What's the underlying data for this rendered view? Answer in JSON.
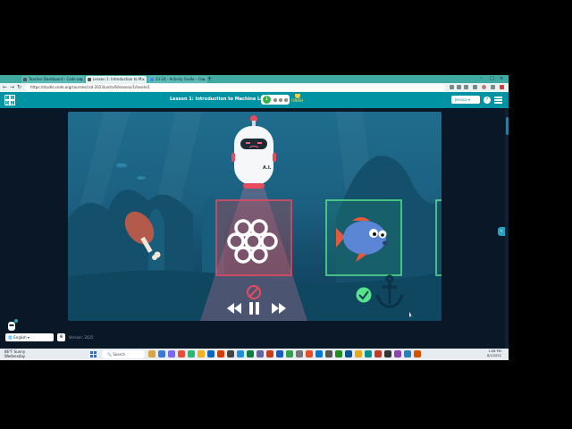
{
  "browser": {
    "tabs": [
      {
        "title": "Teacher Dashboard - Code.org"
      },
      {
        "title": "Lesson 1: Introduction to M..."
      },
      {
        "title": "23-24 - Activity Guide - Clo..."
      }
    ],
    "url": "https://studio.code.org/courses/csd-2023/units/6/lessons/1/levels/1"
  },
  "app": {
    "lesson_title": "Lesson 1: Introduction to Machine Learning",
    "progress_number": "1",
    "finish_label": "FINISH",
    "account_label": "Jessica",
    "help_label": "?",
    "robot_label": "A.I.",
    "language": "English",
    "language_button": "⊕",
    "version_text": "Version: 2025"
  },
  "taskbar": {
    "weather_temp": "86°F",
    "weather_desc": "Sunny",
    "weather_day": "Wednesday",
    "search_placeholder": "Search",
    "time": "1:08 PM",
    "date": "8/1/2024"
  },
  "colors": {
    "header": "#0093a4",
    "tab_strip": "#3fa9a2",
    "reject_box": "#e84a5f",
    "accept_box": "#57e389",
    "ocean_top": "#1f6d8e",
    "ocean_bottom": "#0f3d57"
  }
}
